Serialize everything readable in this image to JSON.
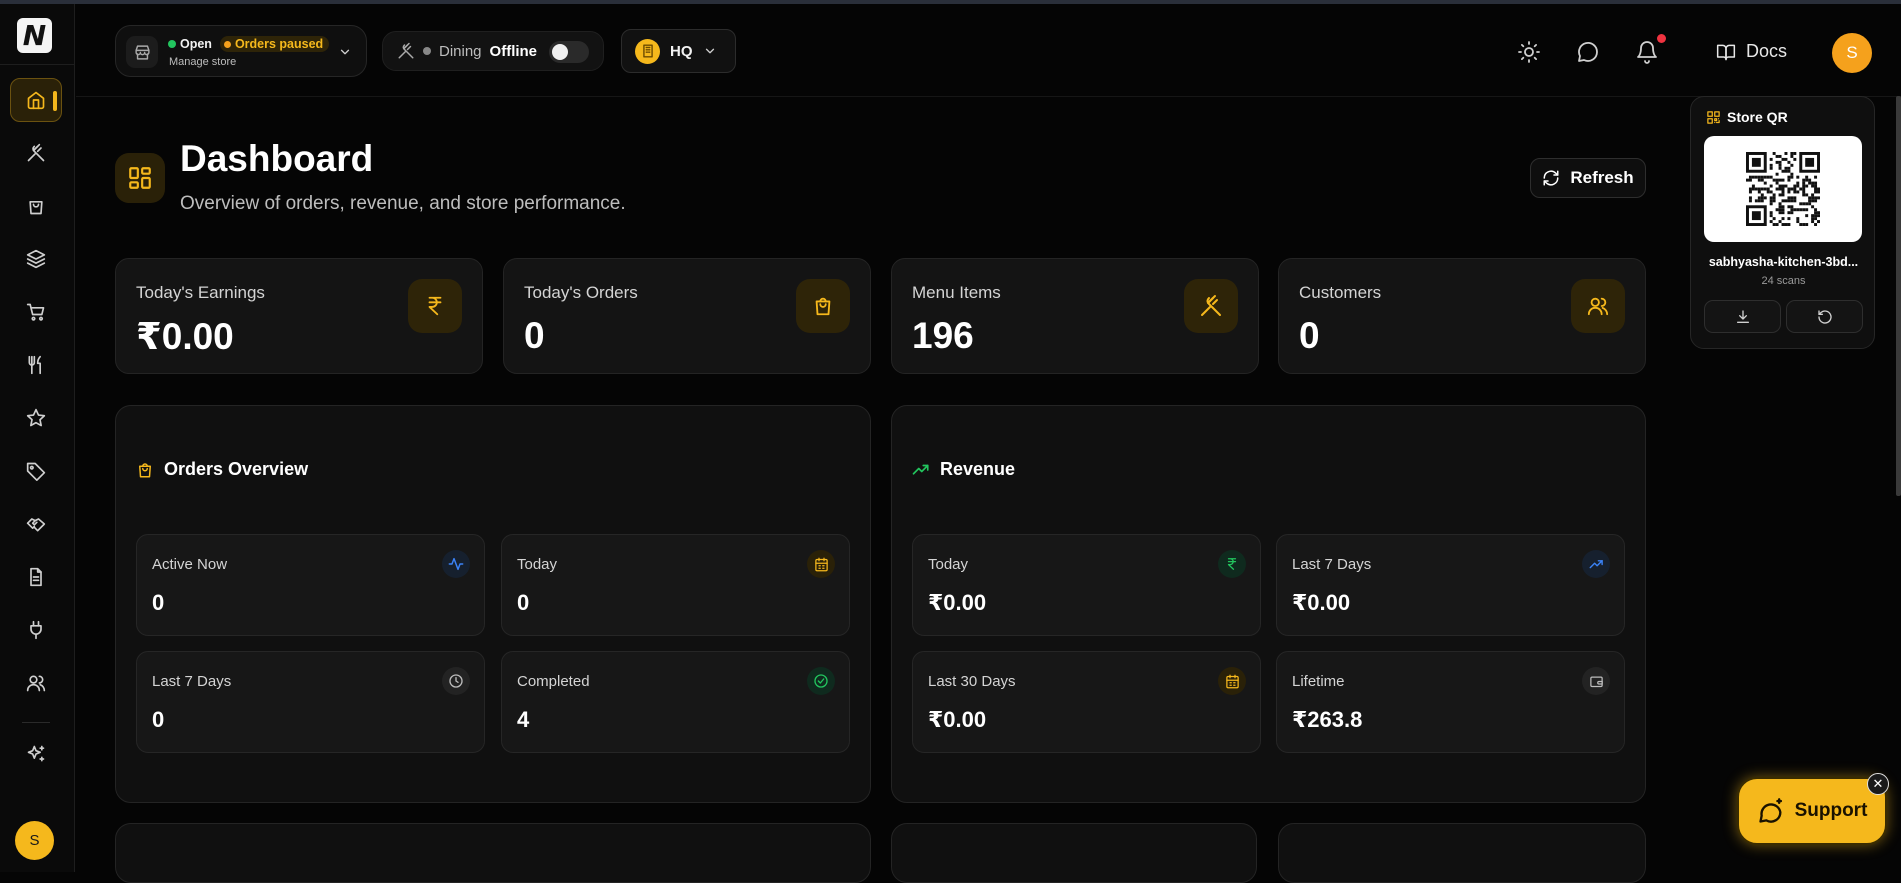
{
  "app": {
    "logo_letter": "N",
    "accent": "#f5b81c"
  },
  "sidebar": {
    "items": [
      {
        "name": "home-icon",
        "active": true
      },
      {
        "name": "utensils-crossed-icon"
      },
      {
        "name": "shopping-bag-icon"
      },
      {
        "name": "layers-icon"
      },
      {
        "name": "shopping-cart-icon"
      },
      {
        "name": "fork-knife-icon"
      },
      {
        "name": "star-icon"
      },
      {
        "name": "tag-icon"
      },
      {
        "name": "handshake-icon"
      },
      {
        "name": "file-text-icon"
      },
      {
        "name": "plug-icon"
      },
      {
        "name": "users-icon"
      },
      {
        "name": "sparkles-icon"
      }
    ],
    "avatar_letter": "S"
  },
  "header": {
    "store": {
      "status": "Open",
      "paused": "Orders paused",
      "manage": "Manage store"
    },
    "dining": {
      "label": "Dining",
      "state": "Offline"
    },
    "branch": {
      "label": "HQ"
    },
    "docs": "Docs",
    "avatar_letter": "S"
  },
  "page": {
    "title": "Dashboard",
    "subtitle": "Overview of orders, revenue, and store performance.",
    "refresh": "Refresh"
  },
  "stats": [
    {
      "label": "Today's Earnings",
      "value": "₹0.00",
      "icon": "rupee-icon"
    },
    {
      "label": "Today's Orders",
      "value": "0",
      "icon": "shopping-bag-icon"
    },
    {
      "label": "Menu Items",
      "value": "196",
      "icon": "utensils-crossed-icon"
    },
    {
      "label": "Customers",
      "value": "0",
      "icon": "users-icon"
    }
  ],
  "orders_overview": {
    "title": "Orders Overview",
    "cards": [
      {
        "label": "Active Now",
        "value": "0",
        "icon": "activity-icon"
      },
      {
        "label": "Today",
        "value": "0",
        "icon": "calendar-icon"
      },
      {
        "label": "Last 7 Days",
        "value": "0",
        "icon": "clock-icon"
      },
      {
        "label": "Completed",
        "value": "4",
        "icon": "check-circle-icon"
      }
    ]
  },
  "revenue": {
    "title": "Revenue",
    "cards": [
      {
        "label": "Today",
        "value": "₹0.00",
        "icon": "rupee-icon"
      },
      {
        "label": "Last 7 Days",
        "value": "₹0.00",
        "icon": "trending-up-icon"
      },
      {
        "label": "Last 30 Days",
        "value": "₹0.00",
        "icon": "calendar-icon"
      },
      {
        "label": "Lifetime",
        "value": "₹263.8",
        "icon": "wallet-icon"
      }
    ]
  },
  "qr": {
    "title": "Store QR",
    "slug": "sabhyasha-kitchen-3bd...",
    "scans": "24 scans"
  },
  "support": {
    "label": "Support",
    "close": "✕"
  }
}
